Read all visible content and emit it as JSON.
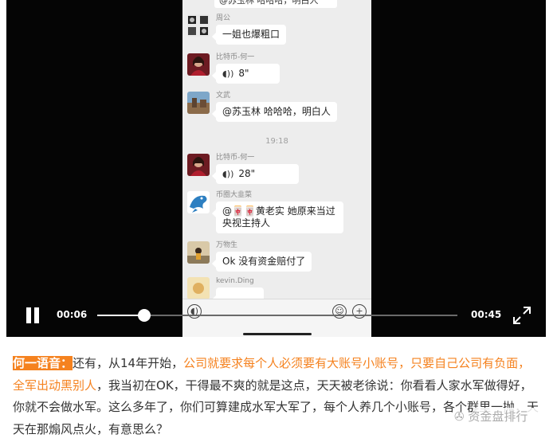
{
  "player": {
    "current_time": "00:06",
    "duration": "00:45",
    "progress_fraction": 0.13,
    "state": "playing"
  },
  "chat": {
    "top_partial_text": "@苏玉林 哈哈哈，明白人",
    "messages": [
      {
        "sender": "周公",
        "text": "一姐也爆粗口"
      },
      {
        "sender": "比特币-何一",
        "voice": "8\""
      },
      {
        "sender": "文武",
        "text": "@苏玉林 哈哈哈，明白人"
      },
      {
        "sender": "比特币-何一",
        "voice": "28\""
      },
      {
        "sender": "币圈大韭菜",
        "text": "@🀄🀄黄老实 她原来当过央视主持人"
      },
      {
        "sender": "万物生",
        "text": "Ok 没有资金赔付了"
      },
      {
        "sender": "kevin.Ding"
      }
    ],
    "timestamp": "19:18"
  },
  "article": {
    "speaker": "何一语音：",
    "p1": "还有，从14年开始，",
    "p2": "公司就要求每个人必须要有大账号小账号，只要自己公司有负面，全军出动黑别人",
    "p3": "，我当初在OK，干得最不爽的就是这点，天天被老徐说：你看看人家水军做得好，你就不会做水军。这么多年了，你们可算建成水军大军了，每个人养几个小账号，各个群里一抛，天天在那煽风点火，有意思么？",
    "watermark": "资金盘排行"
  },
  "colors": {
    "accent": "#f5821f",
    "player_bg": "#050505"
  }
}
